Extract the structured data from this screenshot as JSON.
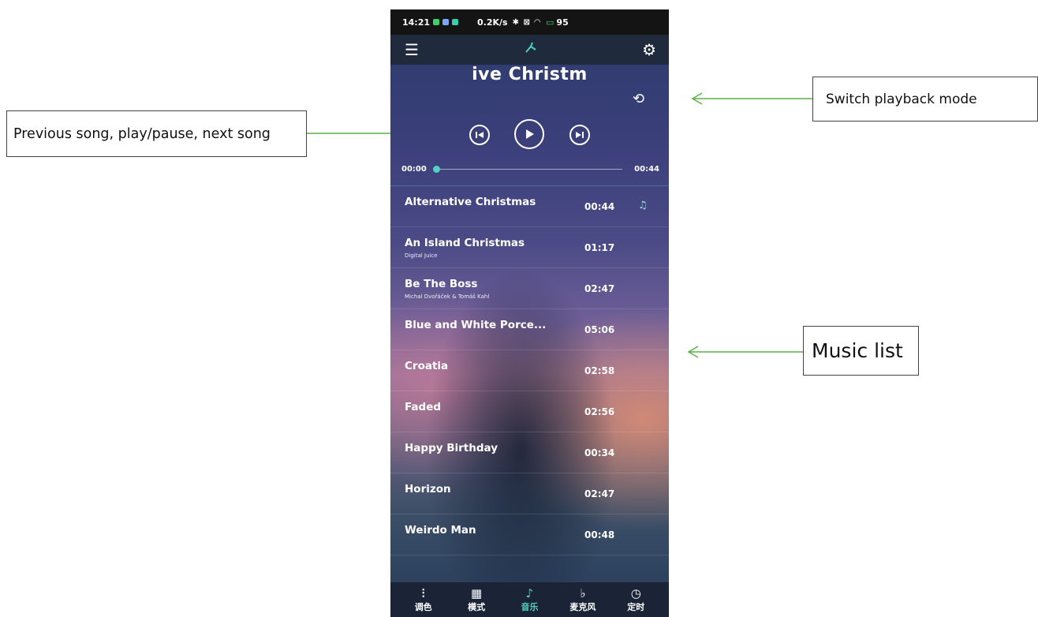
{
  "annotations": {
    "controls": "Previous song, play/pause, next song",
    "mode": "Switch playback mode",
    "list": "Music list"
  },
  "status_bar": {
    "time": "14:21",
    "speed": "0.2K/s",
    "battery": "95"
  },
  "player": {
    "now_playing": "ive Christm",
    "elapsed": "00:00",
    "total": "00:44",
    "progress": 0.0
  },
  "songs": [
    {
      "title": "Alternative Christmas",
      "artist": "",
      "duration": "00:44"
    },
    {
      "title": "An Island Christmas",
      "artist": "Digital Juice",
      "duration": "01:17"
    },
    {
      "title": "Be The Boss",
      "artist": "Michal Dvořáček & Tomáš Kahl",
      "duration": "02:47"
    },
    {
      "title": "Blue and White Porce...",
      "artist": "",
      "duration": "05:06"
    },
    {
      "title": "Croatia",
      "artist": "",
      "duration": "02:58"
    },
    {
      "title": "Faded",
      "artist": "",
      "duration": "02:56"
    },
    {
      "title": "Happy Birthday",
      "artist": "",
      "duration": "00:34"
    },
    {
      "title": "Horizon",
      "artist": "",
      "duration": "02:47"
    },
    {
      "title": "Weirdo Man",
      "artist": "",
      "duration": "00:48"
    }
  ],
  "nav": [
    {
      "label": "调色",
      "icon": "sliders-icon"
    },
    {
      "label": "模式",
      "icon": "grid-icon"
    },
    {
      "label": "音乐",
      "icon": "music-icon"
    },
    {
      "label": "麦克风",
      "icon": "microphone-icon"
    },
    {
      "label": "定时",
      "icon": "timer-icon"
    }
  ],
  "colors": {
    "accent": "#4fd1c5",
    "arrow": "#5ab04a"
  }
}
